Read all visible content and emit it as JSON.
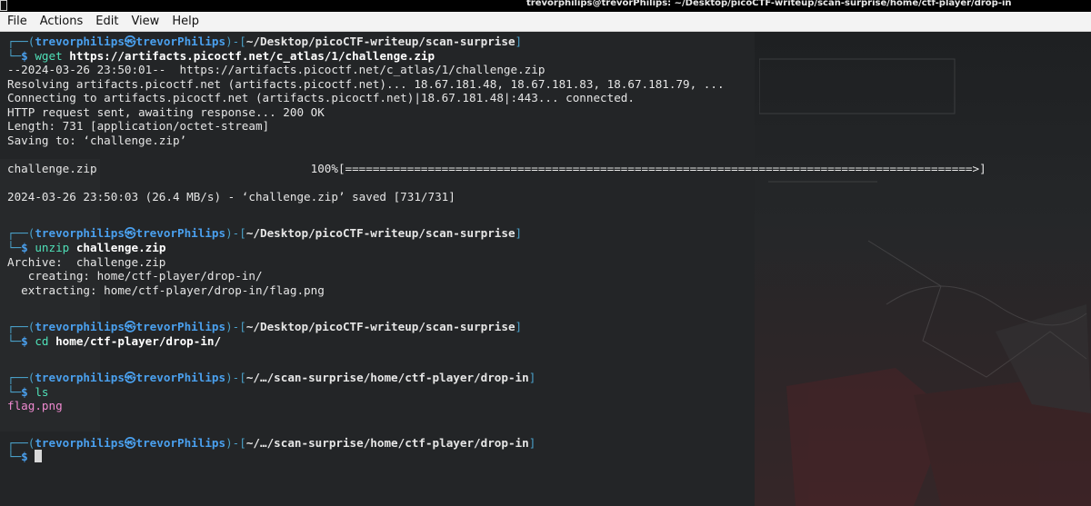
{
  "window": {
    "title": "trevorphilips@trevorPhilips: ~/Desktop/picoCTF-writeup/scan-surprise/home/ctf-player/drop-in"
  },
  "menu": [
    "File",
    "Actions",
    "Edit",
    "View",
    "Help"
  ],
  "prompt": {
    "frame_top_left": "┌──(",
    "user_host": "trevorphilips㉿trevorPhilips",
    "frame_mid": ")-[",
    "frame_end": "]",
    "frame_bottom": "└─",
    "dollar": "$ "
  },
  "blocks": [
    {
      "cwd": "~/Desktop/picoCTF-writeup/scan-surprise",
      "cmd": "wget",
      "arg": " https://artifacts.picoctf.net/c_atlas/1/challenge.zip",
      "output": [
        "--2024-03-26 23:50:01--  https://artifacts.picoctf.net/c_atlas/1/challenge.zip",
        "Resolving artifacts.picoctf.net (artifacts.picoctf.net)... 18.67.181.48, 18.67.181.83, 18.67.181.79, ...",
        "Connecting to artifacts.picoctf.net (artifacts.picoctf.net)|18.67.181.48|:443... connected.",
        "HTTP request sent, awaiting response... 200 OK",
        "Length: 731 [application/octet-stream]",
        "Saving to: ‘challenge.zip’",
        "",
        "challenge.zip                               100%[===========================================================================================>]",
        "",
        "2024-03-26 23:50:03 (26.4 MB/s) - ‘challenge.zip’ saved [731/731]"
      ]
    },
    {
      "cwd": "~/Desktop/picoCTF-writeup/scan-surprise",
      "cmd": "unzip",
      "arg": " challenge.zip",
      "output": [
        "Archive:  challenge.zip",
        "   creating: home/ctf-player/drop-in/",
        "  extracting: home/ctf-player/drop-in/flag.png"
      ]
    },
    {
      "cwd": "~/Desktop/picoCTF-writeup/scan-surprise",
      "cmd": "cd",
      "arg": " home/ctf-player/drop-in/",
      "output": []
    },
    {
      "cwd": "~/…/scan-surprise/home/ctf-player/drop-in",
      "cmd": "ls",
      "arg": "",
      "output": [],
      "files": [
        "flag.png"
      ]
    },
    {
      "cwd": "~/…/scan-surprise/home/ctf-player/drop-in",
      "cmd": "",
      "arg": "",
      "output": [],
      "active": true
    }
  ],
  "colors": {
    "terminal_bg": "#232527",
    "frame": "#4aa0c8",
    "user": "#4aa0ee",
    "command": "#4fe0b8",
    "file": "#f08ad0",
    "text": "#e6e6e6"
  }
}
